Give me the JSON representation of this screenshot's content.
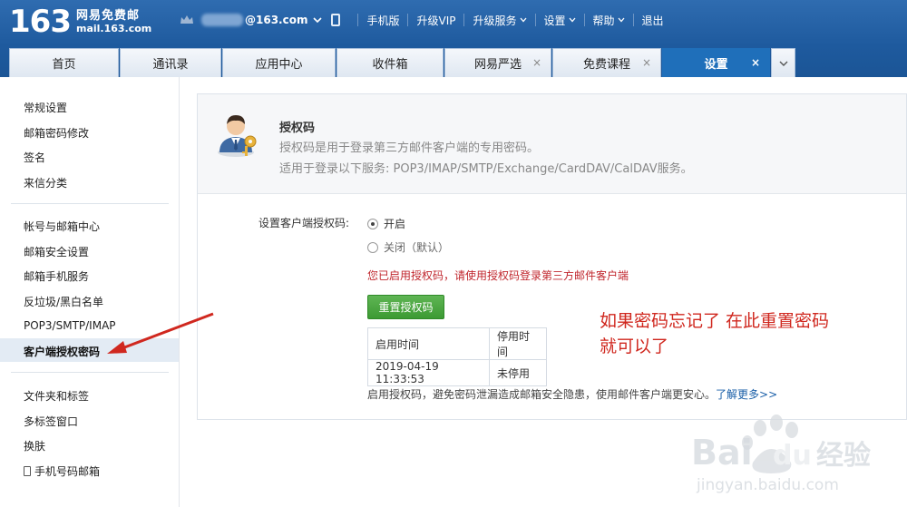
{
  "header": {
    "logo_num": "163",
    "logo_cn": "网易免费邮",
    "logo_en": "mail.163.com",
    "email_domain": "@163.com",
    "links": {
      "mobile": "手机版",
      "vip": "升级VIP",
      "upgrade": "升级服务",
      "settings": "设置",
      "help": "帮助",
      "logout": "退出"
    }
  },
  "tabs": [
    {
      "label": "首页"
    },
    {
      "label": "通讯录"
    },
    {
      "label": "应用中心"
    },
    {
      "label": "收件箱"
    },
    {
      "label": "网易严选",
      "close": "×"
    },
    {
      "label": "免费课程",
      "close": "×"
    },
    {
      "label": "设置",
      "close": "×",
      "active": true
    }
  ],
  "sidebar": {
    "group1": [
      "常规设置",
      "邮箱密码修改",
      "签名",
      "来信分类"
    ],
    "group2": [
      "帐号与邮箱中心",
      "邮箱安全设置",
      "邮箱手机服务",
      "反垃圾/黑白名单",
      "POP3/SMTP/IMAP",
      "客户端授权密码"
    ],
    "group3": [
      "文件夹和标签",
      "多标签窗口",
      "换肤",
      "手机号码邮箱"
    ]
  },
  "panel": {
    "title": "授权码",
    "desc1": "授权码是用于登录第三方邮件客户端的专用密码。",
    "desc2": "适用于登录以下服务: POP3/IMAP/SMTP/Exchange/CardDAV/CalDAV服务。",
    "set_label": "设置客户端授权码:",
    "radio_on": "开启",
    "radio_off": "关闭（默认）",
    "notice": "您已启用授权码，请使用授权码登录第三方邮件客户端",
    "reset_button": "重置授权码",
    "table": {
      "headers": [
        "启用时间",
        "停用时间"
      ],
      "rows": [
        [
          "2019-04-19 11:33:53",
          "未停用"
        ]
      ]
    },
    "footnote": "启用授权码，避免密码泄漏造成邮箱安全隐患，使用邮件客户端更安心。",
    "learn_more": "了解更多>>"
  },
  "annotation": {
    "line1": "如果密码忘记了 在此重置密码",
    "line2": "就可以了"
  },
  "watermark": {
    "brand": "Bai",
    "brand2": "du",
    "cn": "经验",
    "url": "jingyan.baidu.com"
  },
  "colors": {
    "header_blue": "#1e5a9e",
    "active_tab": "#1f6fba",
    "notice_red": "#c0262d",
    "button_green": "#3c9a33",
    "annotation_red": "#d0281f"
  }
}
